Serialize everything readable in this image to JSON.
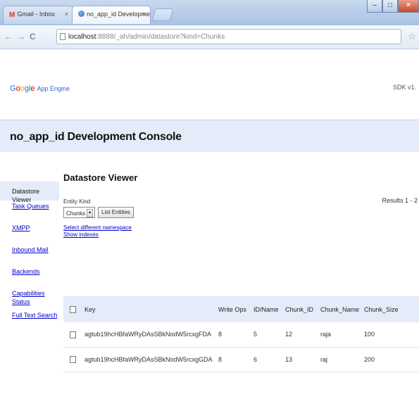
{
  "browser": {
    "tabs": [
      {
        "title": "Gmail - Inbox",
        "icon": "gmail-icon"
      },
      {
        "title": "no_app_id Development C",
        "icon": "appengine-icon"
      }
    ],
    "close_glyph": "×",
    "url_host": "localhost",
    "url_path": ":8888/_ah/admin/datastore?kind=Chunks"
  },
  "header": {
    "logo_letters": [
      "G",
      "o",
      "o",
      "g",
      "l",
      "e"
    ],
    "logo_product": "App Engine",
    "sdk_text": "SDK v1."
  },
  "console_title": "no_app_id Development Console",
  "sidebar": {
    "items": [
      {
        "label": "Datastore Viewer",
        "selected": true
      },
      {
        "label": "Task Queues"
      },
      {
        "label": "XMPP"
      },
      {
        "label": "Inbound Mail"
      },
      {
        "label": "Backends"
      },
      {
        "label": "Capabilities Status"
      },
      {
        "label": "Full Text Search"
      }
    ]
  },
  "main": {
    "title": "Datastore Viewer",
    "entity_kind_label": "Entity Kind",
    "kind_selected": "Chunks",
    "list_entities_label": "List Entities",
    "select_namespace_link": "Select different namespace",
    "show_indexes_link": "Show indexes",
    "results_text": "Results 1 - 2"
  },
  "table": {
    "headers": [
      "Key",
      "Write Ops",
      "ID/Name",
      "Chunk_ID",
      "Chunk_Name",
      "Chunk_Size"
    ],
    "rows": [
      [
        "agtub19hcHBfaWRyDAsSBkNodW5rcxgFDA",
        "8",
        "5",
        "12",
        "raja",
        "100"
      ],
      [
        "agtub19hcHBfaWRyDAsSBkNodW5rcxgGDA",
        "8",
        "6",
        "13",
        "raj",
        "200"
      ]
    ]
  },
  "colors": {
    "accent_bg": "#e5ecf9",
    "link": "#0000cc"
  }
}
